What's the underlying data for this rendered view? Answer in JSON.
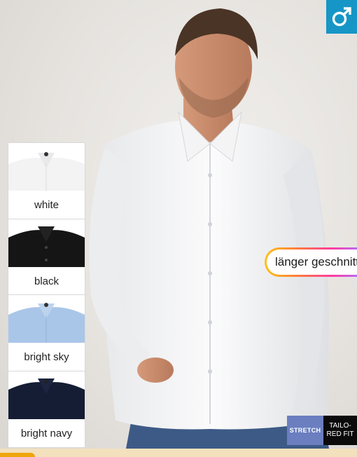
{
  "gender_icon": "male-symbol-icon",
  "accent_color": "#1596c6",
  "swatches": [
    {
      "label": "white",
      "shirt_color": "#f6f6f6"
    },
    {
      "label": "black",
      "shirt_color": "#151515"
    },
    {
      "label": "bright sky",
      "shirt_color": "#a9c6e8"
    },
    {
      "label": "bright navy",
      "shirt_color": "#141d33"
    }
  ],
  "callout": {
    "text": "länger geschnitten"
  },
  "badges": {
    "stretch": "STRETCH",
    "fit_line1": "TAILO-",
    "fit_line2": "RED FIT"
  }
}
